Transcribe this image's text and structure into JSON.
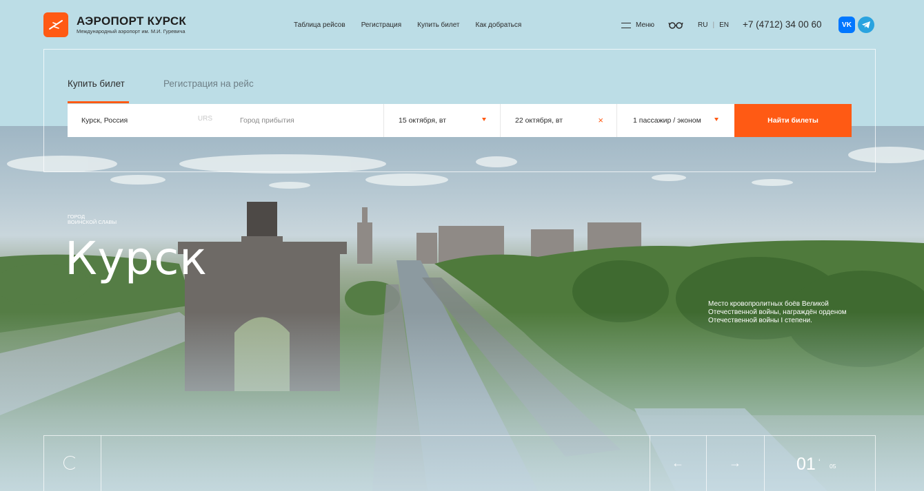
{
  "header": {
    "logo_title": "АЭРОПОРТ КУРСК",
    "logo_subtitle": "Международный аэропорт им. М.И. Гуревича",
    "nav": [
      "Таблица рейсов",
      "Регистрация",
      "Купить билет",
      "Как добраться"
    ],
    "menu_label": "Меню",
    "lang_ru": "RU",
    "lang_sep": "|",
    "lang_en": "EN",
    "phone": "+7 (4712) 34 00 60",
    "social_vk": "VK"
  },
  "booking": {
    "tab_buy": "Купить билет",
    "tab_reg": "Регистрация на рейс",
    "from_value": "Курск, Россия",
    "from_code": "URS",
    "to_placeholder": "Город прибытия",
    "date_there": "15 октября, вт",
    "date_back": "22 октября, вт",
    "clear_symbol": "×",
    "passengers": "1 пассажир / эконом",
    "search_button": "Найти билеты"
  },
  "hero": {
    "tag_line1": "Город",
    "tag_line2": "воинской славы",
    "city": "Курск",
    "description": "Место кровопролитных боёв Великой Отечественной войны, награждён орденом Отечественной войны I степени."
  },
  "slider": {
    "prev_arrow": "←",
    "next_arrow": "→",
    "current": "01",
    "tick": "‘",
    "total": "05"
  },
  "colors": {
    "accent": "#ff5a14",
    "header_bg": "#bcdde6",
    "vk": "#0077ff",
    "telegram": "#2aa3df"
  },
  "icons": [
    "plane-logo-icon",
    "burger-icon",
    "glasses-icon",
    "vk-icon",
    "telegram-icon",
    "caret-down-icon",
    "spinner-icon",
    "arrow-left-icon",
    "arrow-right-icon"
  ]
}
